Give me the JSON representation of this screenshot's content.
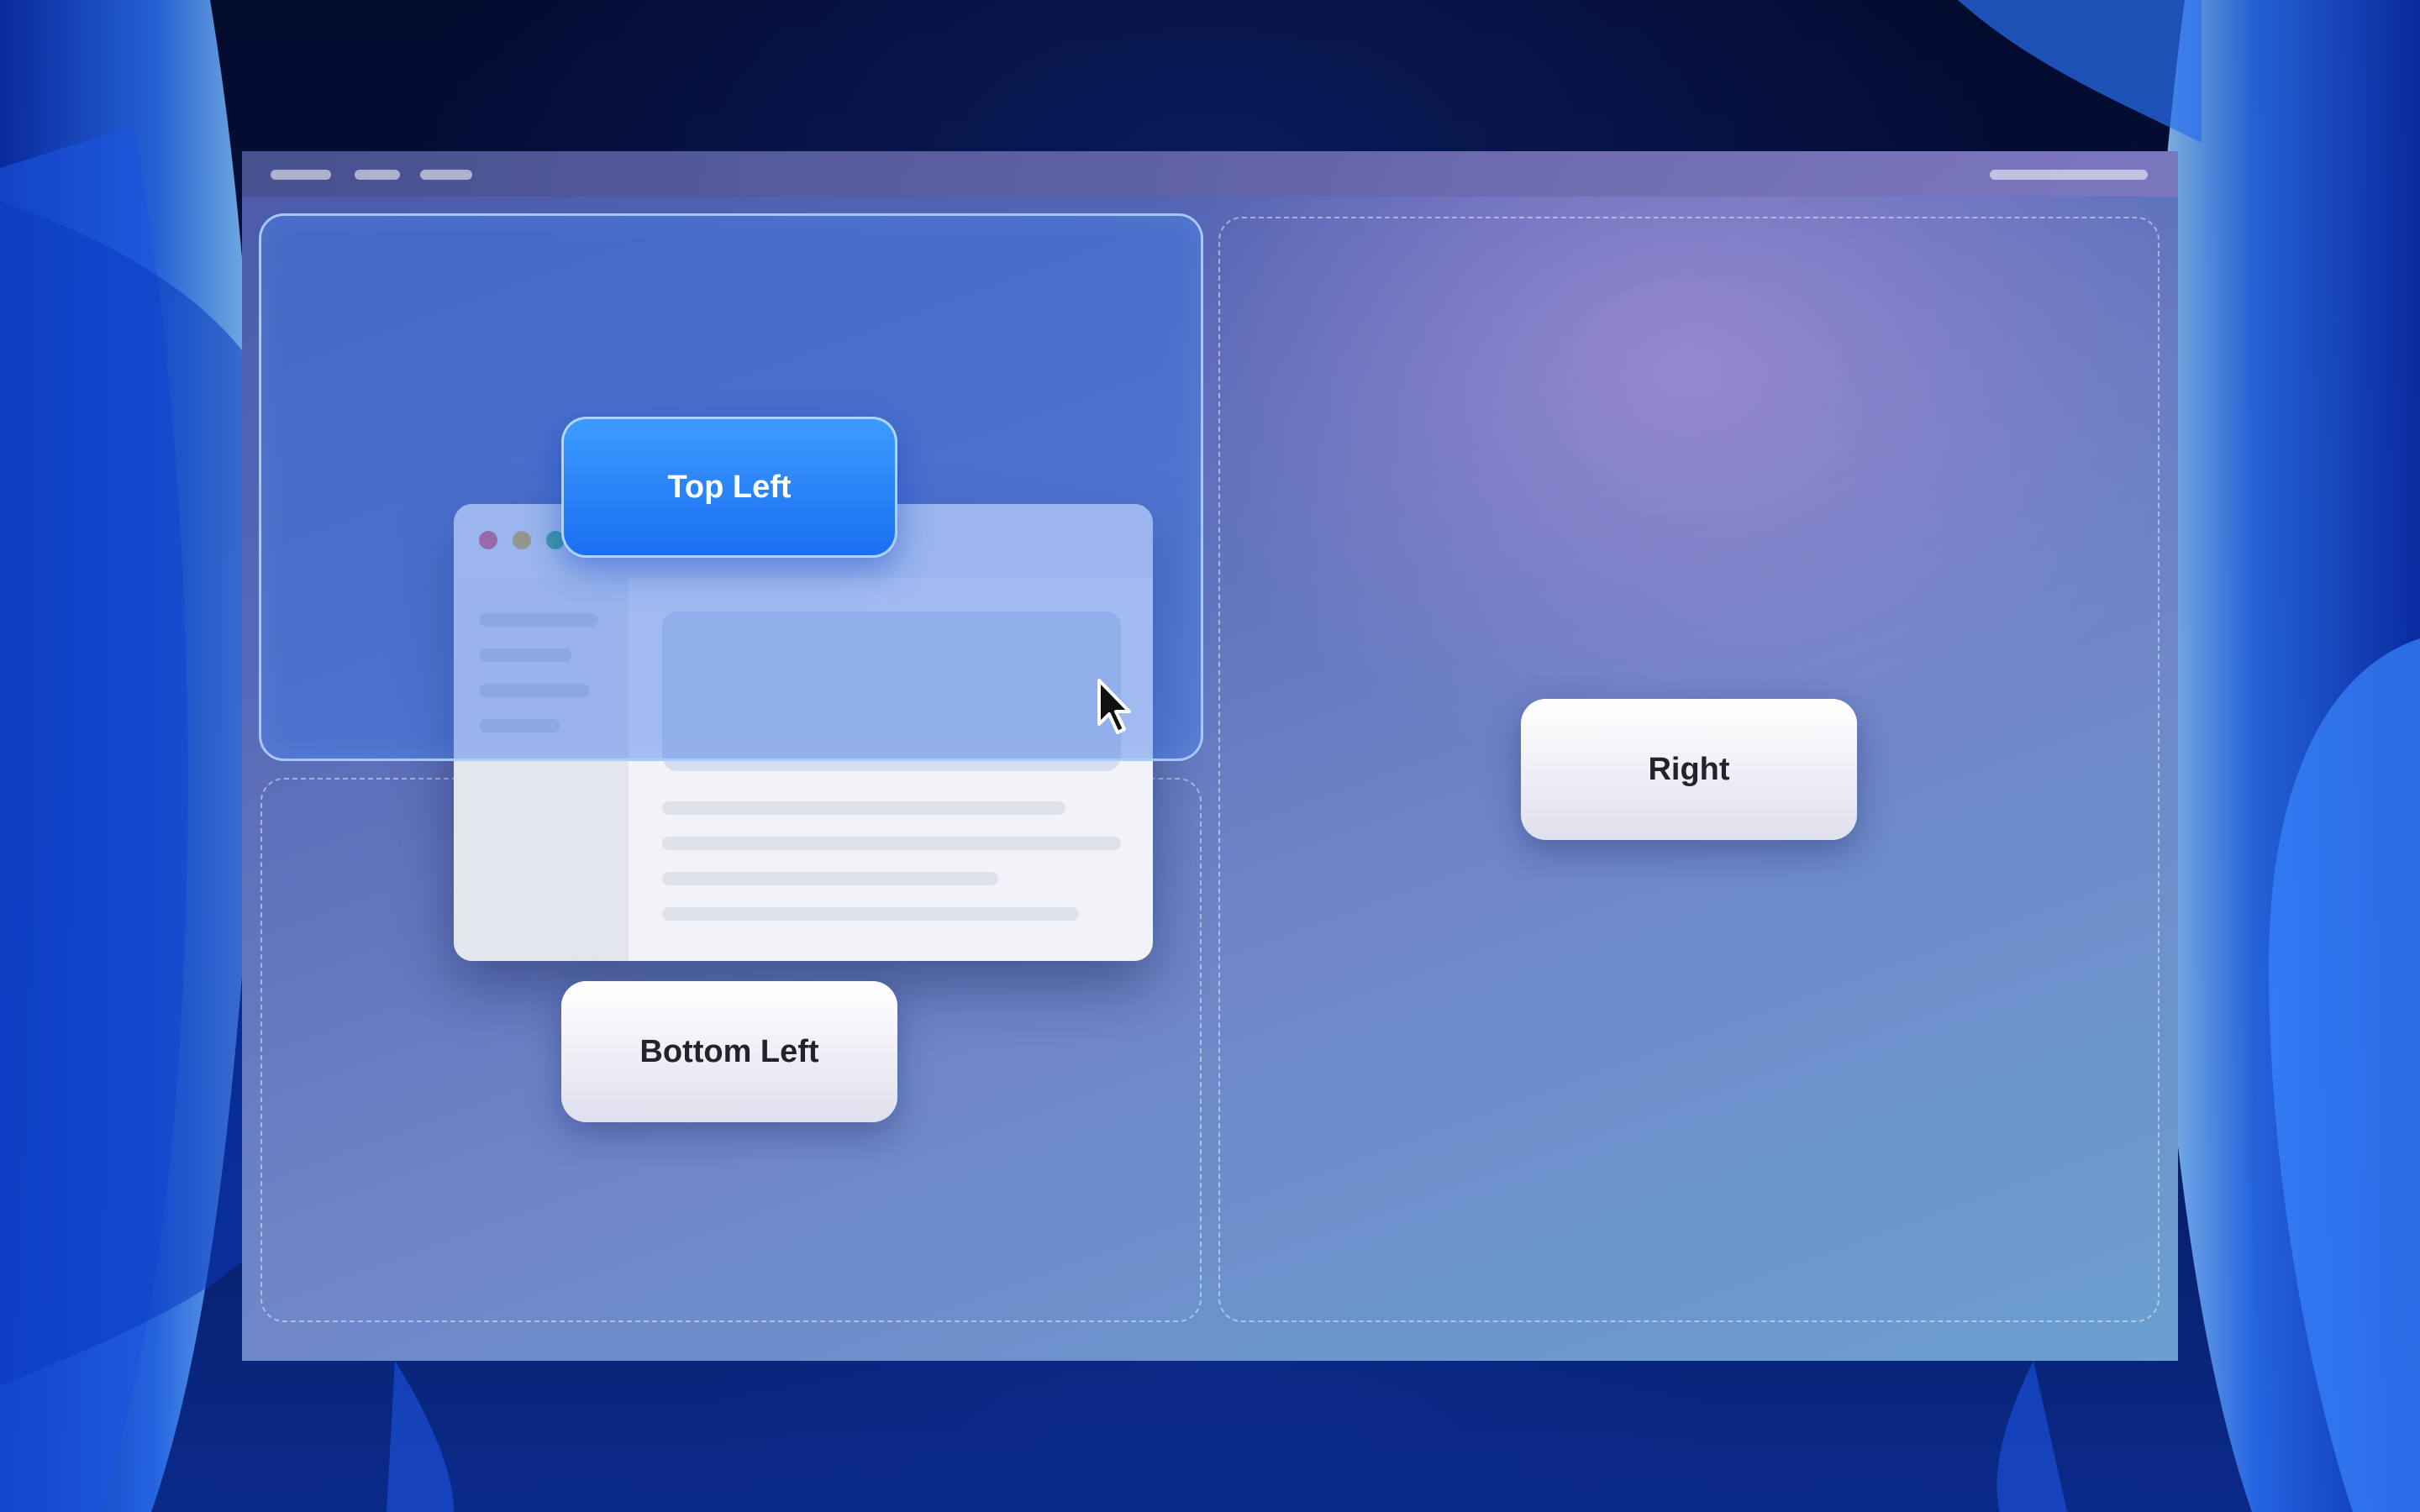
{
  "wallpaper": {
    "name": "blue-abstract-wallpaper"
  },
  "menubar": {
    "items": [
      "",
      "",
      ""
    ]
  },
  "zones": {
    "top_left": {
      "label": "Top Left",
      "state": "highlighted"
    },
    "bottom_left": {
      "label": "Bottom Left"
    },
    "right": {
      "label": "Right"
    }
  },
  "app_window": {
    "traffic_lights": {
      "close": "#e0607a",
      "minimize": "#d9b04a",
      "maximize": "#3fb46a"
    }
  },
  "colors": {
    "accent": "#1a6ff0",
    "zone_highlight": "#3c78e6"
  },
  "icons": {
    "cursor": "cursor-arrow-icon"
  }
}
